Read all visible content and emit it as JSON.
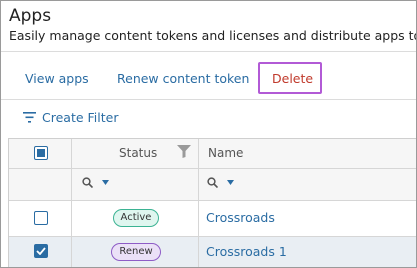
{
  "header": {
    "title": "Apps",
    "subtitle": "Easily manage content tokens and licenses and distribute apps to devices."
  },
  "actions": {
    "view_apps": "View apps",
    "renew_token": "Renew content token",
    "delete": "Delete"
  },
  "filter": {
    "create_label": "Create Filter"
  },
  "table": {
    "columns": {
      "status": "Status",
      "name": "Name"
    },
    "rows": [
      {
        "selected": false,
        "status": "Active",
        "name": "Crossroads"
      },
      {
        "selected": true,
        "status": "Renew",
        "name": "Crossroads 1"
      }
    ]
  },
  "colors": {
    "link": "#2a6ca3",
    "delete": "#c0392b",
    "highlight_border": "#b25ad6",
    "active_pill_border": "#3cb393",
    "renew_pill_border": "#8e5cc6"
  }
}
